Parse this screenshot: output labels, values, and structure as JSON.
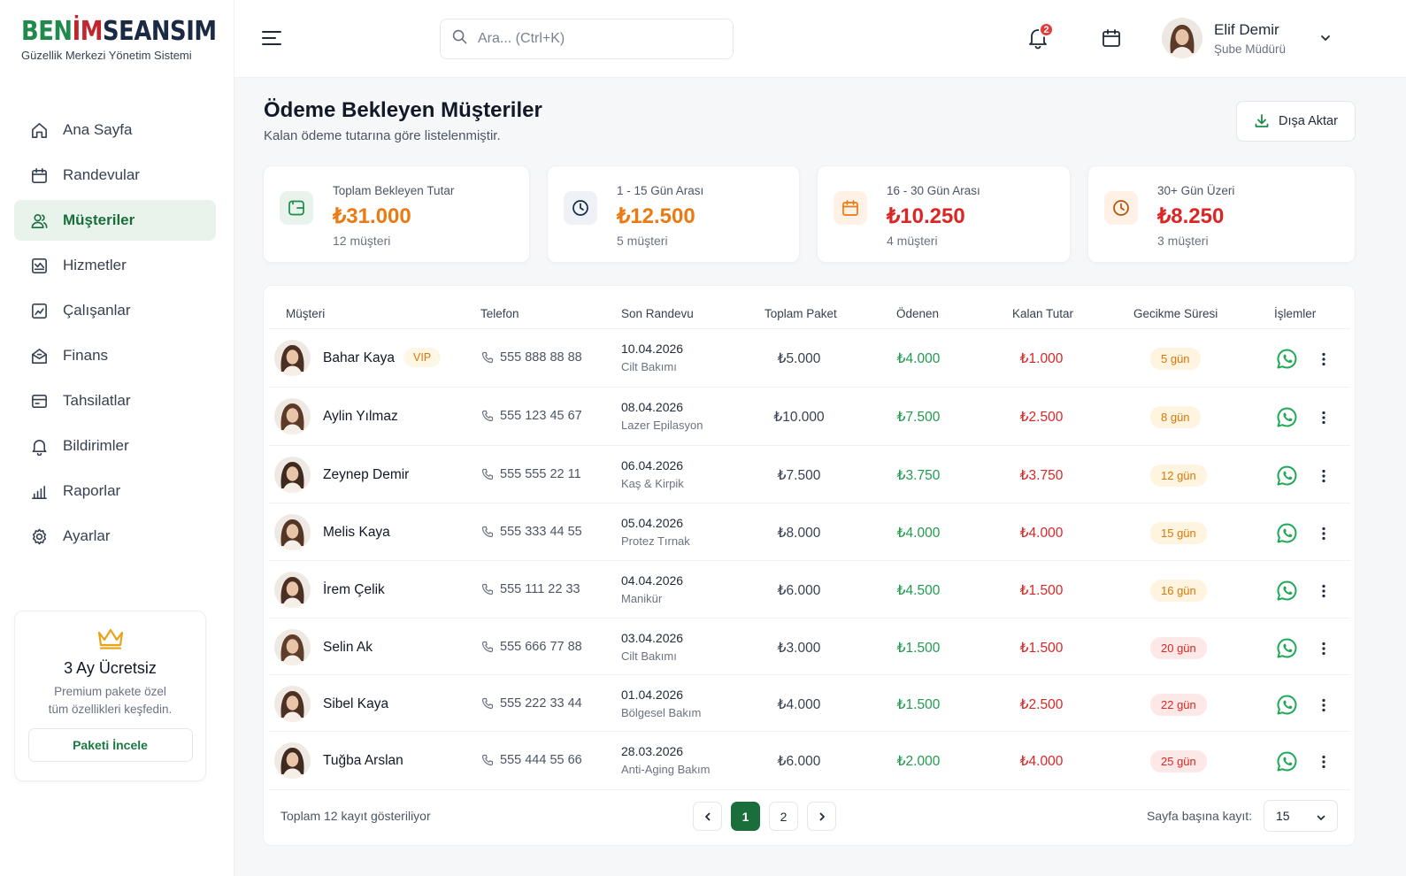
{
  "brand": {
    "logo_parts": [
      "BEN",
      "İM",
      "SEANSIM"
    ],
    "subtitle": "Güzellik Merkezi Yönetim Sistemi",
    "colors": {
      "green": "#1f8a4c",
      "red": "#c0262d",
      "navy": "#1b2a44"
    }
  },
  "sidebar": {
    "items": [
      {
        "label": "Ana Sayfa",
        "icon": "home-icon",
        "active": false
      },
      {
        "label": "Randevular",
        "icon": "calendar-icon",
        "active": false
      },
      {
        "label": "Müşteriler",
        "icon": "users-icon",
        "active": true
      },
      {
        "label": "Hizmetler",
        "icon": "services-icon",
        "active": false
      },
      {
        "label": "Çalışanlar",
        "icon": "employees-icon",
        "active": false
      },
      {
        "label": "Finans",
        "icon": "finance-icon",
        "active": false
      },
      {
        "label": "Tahsilatlar",
        "icon": "collections-icon",
        "active": false
      },
      {
        "label": "Bildirimler",
        "icon": "bell-icon",
        "active": false
      },
      {
        "label": "Raporlar",
        "icon": "reports-icon",
        "active": false
      },
      {
        "label": "Ayarlar",
        "icon": "settings-icon",
        "active": false
      }
    ],
    "promo": {
      "title": "3 Ay Ücretsiz",
      "text_line1": "Premium pakete özel",
      "text_line2": "tüm özellikleri keşfedin.",
      "button": "Paketi İncele"
    }
  },
  "header": {
    "search_placeholder": "Ara... (Ctrl+K)",
    "notification_count": "2",
    "user": {
      "name": "Elif Demir",
      "role": "Şube Müdürü"
    }
  },
  "page": {
    "title": "Ödeme Bekleyen Müşteriler",
    "subtitle": "Kalan ödeme tutarına göre listelenmiştir.",
    "export_label": "Dışa Aktar"
  },
  "stats": [
    {
      "label": "Toplam Bekleyen Tutar",
      "value": "₺31.000",
      "count": "12 müşteri",
      "icon": "wallet-icon",
      "color": "#ea7a12",
      "bg": "#e8f3ec",
      "iconColor": "#1f8a4c"
    },
    {
      "label": "1 - 15 Gün Arası",
      "value": "₺12.500",
      "count": "5 müşteri",
      "icon": "clock-icon",
      "color": "#ea7a12",
      "bg": "#eef1f6",
      "iconColor": "#1b2a44"
    },
    {
      "label": "16 - 30 Gün Arası",
      "value": "₺10.250",
      "count": "4 müşteri",
      "icon": "calendar-icon",
      "color": "#dc2626",
      "bg": "#fff1e6",
      "iconColor": "#ea7a12"
    },
    {
      "label": "30+ Gün Üzeri",
      "value": "₺8.250",
      "count": "3 müşteri",
      "icon": "clock-icon",
      "color": "#dc2626",
      "bg": "#fff1e6",
      "iconColor": "#b45309"
    }
  ],
  "table": {
    "headers": [
      "Müşteri",
      "Telefon",
      "Son Randevu",
      "Toplam Paket",
      "Ödenen",
      "Kalan Tutar",
      "Gecikme Süresi",
      "İşlemler"
    ],
    "rows": [
      {
        "name": "Bahar Kaya",
        "vip": "VIP",
        "phone": "555 888 88 88",
        "date": "10.04.2026",
        "service": "Cilt Bakımı",
        "total": "₺5.000",
        "paid": "₺4.000",
        "remaining": "₺1.000",
        "delay": "5 gün",
        "delay_color": "#d97706",
        "delay_bg": "#fff4e0"
      },
      {
        "name": "Aylin Yılmaz",
        "vip": "",
        "phone": "555 123 45 67",
        "date": "08.04.2026",
        "service": "Lazer Epilasyon",
        "total": "₺10.000",
        "paid": "₺7.500",
        "remaining": "₺2.500",
        "delay": "8 gün",
        "delay_color": "#d97706",
        "delay_bg": "#fff4e0"
      },
      {
        "name": "Zeynep Demir",
        "vip": "",
        "phone": "555 555 22 11",
        "date": "06.04.2026",
        "service": "Kaş & Kirpik",
        "total": "₺7.500",
        "paid": "₺3.750",
        "remaining": "₺3.750",
        "delay": "12 gün",
        "delay_color": "#d97706",
        "delay_bg": "#fff4e0"
      },
      {
        "name": "Melis Kaya",
        "vip": "",
        "phone": "555 333 44 55",
        "date": "05.04.2026",
        "service": "Protez Tırnak",
        "total": "₺8.000",
        "paid": "₺4.000",
        "remaining": "₺4.000",
        "delay": "15 gün",
        "delay_color": "#d97706",
        "delay_bg": "#fff4e0"
      },
      {
        "name": "İrem Çelik",
        "vip": "",
        "phone": "555 111 22 33",
        "date": "04.04.2026",
        "service": "Manikür",
        "total": "₺6.000",
        "paid": "₺4.500",
        "remaining": "₺1.500",
        "delay": "16 gün",
        "delay_color": "#d97706",
        "delay_bg": "#fff4e0"
      },
      {
        "name": "Selin Ak",
        "vip": "",
        "phone": "555 666 77 88",
        "date": "03.04.2026",
        "service": "Cilt Bakımı",
        "total": "₺3.000",
        "paid": "₺1.500",
        "remaining": "₺1.500",
        "delay": "20 gün",
        "delay_color": "#dc2626",
        "delay_bg": "#fde8e8"
      },
      {
        "name": "Sibel Kaya",
        "vip": "",
        "phone": "555 222 33 44",
        "date": "01.04.2026",
        "service": "Bölgesel Bakım",
        "total": "₺4.000",
        "paid": "₺1.500",
        "remaining": "₺2.500",
        "delay": "22 gün",
        "delay_color": "#dc2626",
        "delay_bg": "#fde8e8"
      },
      {
        "name": "Tuğba Arslan",
        "vip": "",
        "phone": "555 444 55 66",
        "date": "28.03.2026",
        "service": "Anti-Aging Bakım",
        "total": "₺6.000",
        "paid": "₺2.000",
        "remaining": "₺4.000",
        "delay": "25 gün",
        "delay_color": "#dc2626",
        "delay_bg": "#fde8e8"
      }
    ],
    "footer": {
      "summary": "Toplam 12 kayıt gösteriliyor",
      "pages": [
        "1",
        "2"
      ],
      "current_page": "1",
      "per_page_label": "Sayfa başına kayıt:",
      "per_page_value": "15"
    }
  }
}
